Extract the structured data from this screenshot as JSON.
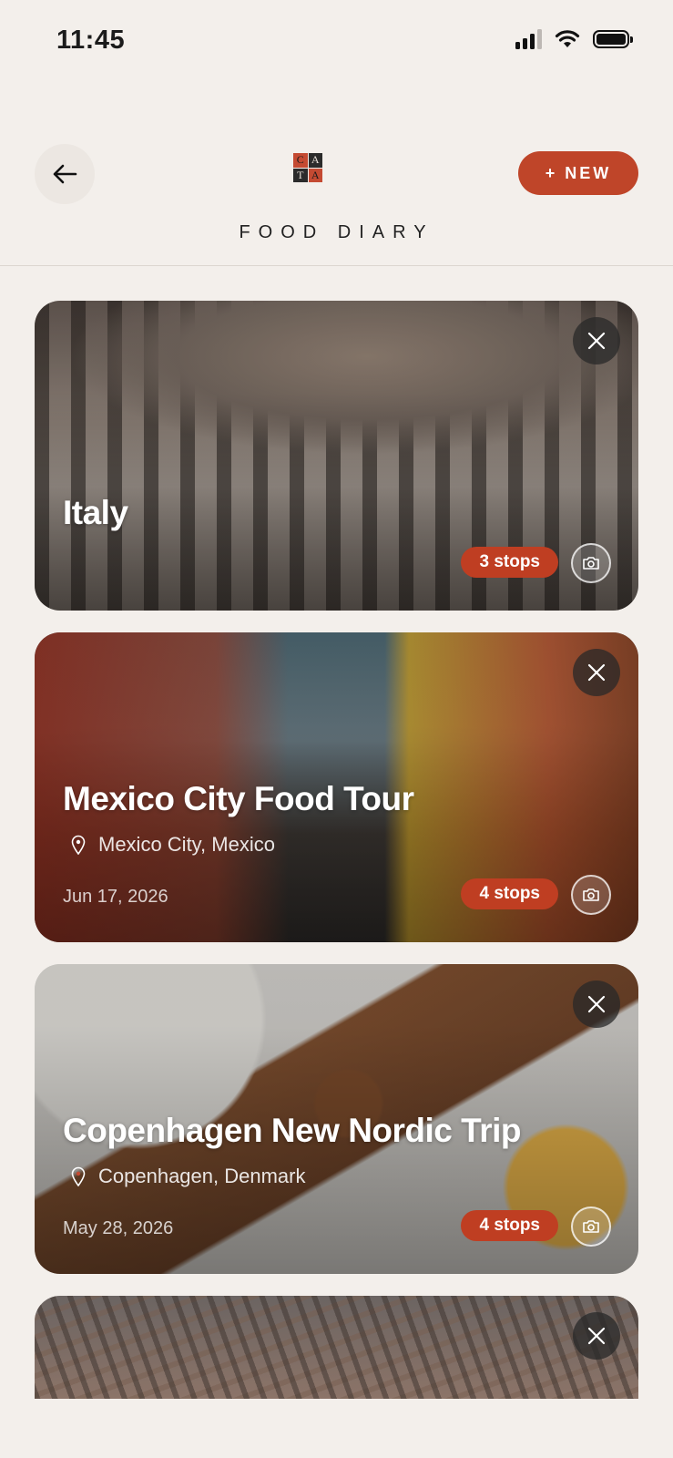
{
  "status_bar": {
    "time": "11:45"
  },
  "header": {
    "logo_letters": [
      "C",
      "A",
      "T",
      "A"
    ],
    "title": "FOOD DIARY",
    "new_button": "+ NEW"
  },
  "trips": [
    {
      "title": "Italy",
      "location": "",
      "date": "",
      "stops": "3 stops"
    },
    {
      "title": "Mexico City Food Tour",
      "location": "Mexico City, Mexico",
      "date": "Jun 17, 2026",
      "stops": "4 stops"
    },
    {
      "title": "Copenhagen New Nordic Trip",
      "location": "Copenhagen, Denmark",
      "date": "May 28, 2026",
      "stops": "4 stops"
    },
    {
      "title": "",
      "location": "",
      "date": "",
      "stops": ""
    }
  ],
  "colors": {
    "accent": "#bf4529",
    "background": "#f3efeb"
  }
}
